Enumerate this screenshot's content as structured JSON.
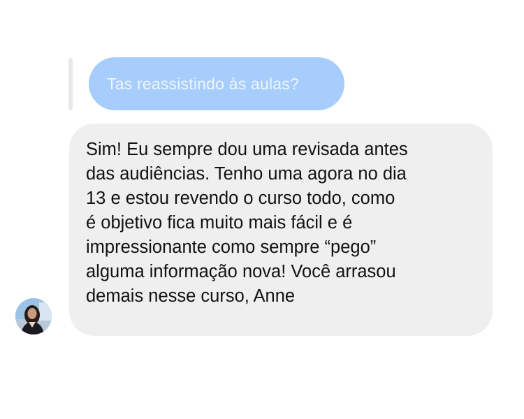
{
  "conversation": {
    "quoted_message": {
      "text": "Tas reassistindo às aulas?"
    },
    "reply_message": {
      "lines": [
        "Sim! Eu sempre dou uma revisada antes",
        "das audiências. Tenho uma agora no dia",
        "13 e estou revendo o curso todo, como",
        "é objetivo fica muito mais fácil e é",
        "impressionante como sempre “pego”",
        "alguma informação nova! Você arrasou",
        "demais nesse curso, Anne"
      ]
    },
    "sender": {
      "avatar_icon": "user-avatar-photo"
    }
  },
  "colors": {
    "quoted_bubble": "#a6cdfb",
    "quoted_text": "#eef5fe",
    "reply_bubble": "#efeff0",
    "reply_text": "#111111",
    "reply_bar": "#e8e8ea"
  }
}
